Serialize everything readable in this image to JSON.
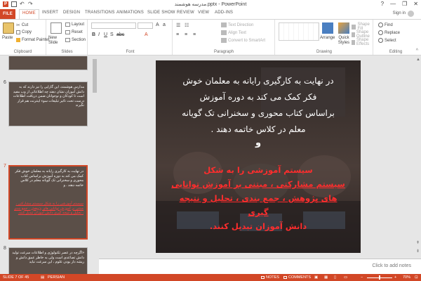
{
  "window": {
    "title": "مدرسه هوشمند.pptx - PowerPoint",
    "app_logo": "P",
    "help": "?",
    "minimize": "—",
    "restore": "❐",
    "close": "✕"
  },
  "tabs": [
    "FILE",
    "HOME",
    "INSERT",
    "DESIGN",
    "TRANSITIONS",
    "ANIMATIONS",
    "SLIDE SHOW",
    "REVIEW",
    "VIEW",
    "ADD-INS"
  ],
  "active_tab": "HOME",
  "signin": "Sign in",
  "ribbon": {
    "clipboard": {
      "label": "Clipboard",
      "paste": "Paste",
      "cut": "Cut",
      "copy": "Copy",
      "format_painter": "Format Painter"
    },
    "slides": {
      "label": "Slides",
      "new_slide": "New Slide",
      "layout": "Layout",
      "reset": "Reset",
      "section": "Section"
    },
    "font": {
      "label": "Font",
      "font_name": "",
      "font_size": ""
    },
    "paragraph": {
      "label": "Paragraph",
      "text_direction": "Text Direction",
      "align_text": "Align Text",
      "convert_smartart": "Convert to SmartArt"
    },
    "drawing": {
      "label": "Drawing",
      "arrange": "Arrange",
      "quick_styles": "Quick Styles",
      "shape_fill": "Shape Fill",
      "shape_outline": "Shape Outline",
      "shape_effects": "Shape Effects"
    },
    "editing": {
      "label": "Editing",
      "find": "Find",
      "replace": "Replace",
      "select": "Select"
    }
  },
  "thumbnails": [
    {
      "number": "",
      "text": "",
      "red_text": ""
    },
    {
      "number": "6",
      "text": "مدارس هوشمند، این گارایی را نیز دارند که به دانش آموزان نشان دهند چه اطلاعاتی از وب مفید است تا کودکان و نوجوانان ضمن دریافت اطلاعات درست تحت تاثیر تبلیغات سوء اینترنت هم قرار نگیرند",
      "red_text": ""
    },
    {
      "number": "7",
      "text": "در نهایت به کارگیری رایانه به معلمان خوش فکر کمک می کند به دوره آموزش براساس کتاب محوری و سخنرانی تک گویانه معلم در کلاس خاتمه دهند . و",
      "red_text": "سیستم آموزشی را به شکل سیستم مشارکتی ، مبتنی بر آموزش توانایی های پژوهش ، جمع بندی ، تحلیل و نتیجه گیری دانش آموزان تبدیل کنند."
    },
    {
      "number": "8",
      "text": "«اگرچه در عصر تکنولوژی و اطلاعات سرعت تولید دانش تصاعدی است ولی به خاطر عمق دانش و ریشه دار بودن علوم ، این سرعت نباید",
      "red_text": ""
    }
  ],
  "slide": {
    "lines_white": [
      "در نهایت به کارگیری رایانه به معلمان خوش",
      "فکر کمک می کند به دوره آموزش",
      "براساس کتاب محوری و سخنرانی تک گویانه",
      "معلم در کلاس خاتمه دهند ."
    ],
    "and": "و",
    "lines_red": [
      "سیستم آموزشی را به شکل",
      "سیستم مشارکتی ، مبتنی بر آموزش توانایی",
      "های پژوهش ، جمع بندی ، تحلیل و نتیجه",
      "گیری",
      "دانش آموزان تبدیل کنند."
    ]
  },
  "notes_placeholder": "Click to add notes",
  "status": {
    "slide_info": "SLIDE 7 OF 45",
    "language": "PERSIAN",
    "notes": "NOTES",
    "comments": "COMMENTS",
    "zoom_minus": "−",
    "zoom_plus": "+",
    "zoom": "70%"
  },
  "colors": {
    "accent": "#d24726",
    "slide_red": "#ff2d2d"
  },
  "icons": [
    "app-logo-icon",
    "save-icon",
    "undo-icon",
    "redo-icon",
    "paste-icon",
    "cut-icon",
    "copy-icon",
    "format-painter-icon",
    "new-slide-icon",
    "layout-icon",
    "reset-icon",
    "section-icon",
    "arrange-icon",
    "quick-styles-icon",
    "find-icon",
    "replace-icon",
    "select-icon",
    "notes-icon",
    "comments-icon",
    "fit-slide-icon"
  ]
}
